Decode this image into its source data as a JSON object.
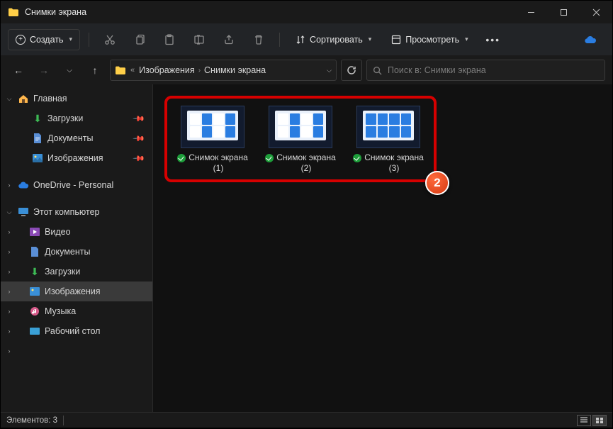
{
  "window": {
    "title": "Снимки экрана"
  },
  "toolbar": {
    "new_label": "Создать",
    "sort_label": "Сортировать",
    "view_label": "Просмотреть"
  },
  "breadcrumb": {
    "parent": "Изображения",
    "current": "Снимки экрана"
  },
  "search": {
    "placeholder": "Поиск в: Снимки экрана"
  },
  "sidebar": {
    "home": "Главная",
    "downloads": "Загрузки",
    "documents": "Документы",
    "pictures": "Изображения",
    "onedrive": "OneDrive - Personal",
    "this_pc": "Этот компьютер",
    "videos": "Видео",
    "documents2": "Документы",
    "downloads2": "Загрузки",
    "pictures2": "Изображения",
    "music": "Музыка",
    "desktop": "Рабочий стол"
  },
  "files": [
    {
      "name": "Снимок экрана (1)"
    },
    {
      "name": "Снимок экрана (2)"
    },
    {
      "name": "Снимок экрана (3)"
    }
  ],
  "status": {
    "items_label": "Элементов: 3"
  },
  "annotation": {
    "badge": "2"
  }
}
